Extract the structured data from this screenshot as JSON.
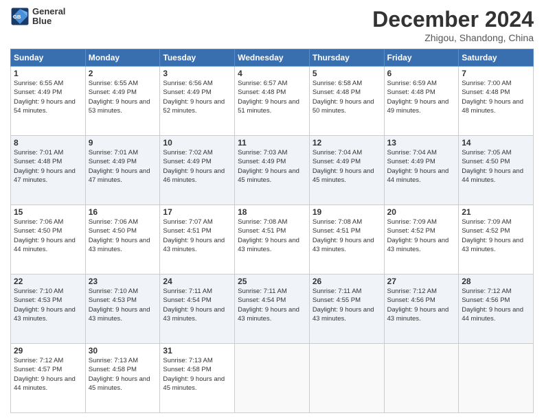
{
  "logo": {
    "line1": "General",
    "line2": "Blue"
  },
  "header": {
    "month": "December 2024",
    "location": "Zhigou, Shandong, China"
  },
  "days_of_week": [
    "Sunday",
    "Monday",
    "Tuesday",
    "Wednesday",
    "Thursday",
    "Friday",
    "Saturday"
  ],
  "weeks": [
    [
      {
        "day": "1",
        "sunrise": "6:55 AM",
        "sunset": "4:49 PM",
        "daylight": "9 hours and 54 minutes."
      },
      {
        "day": "2",
        "sunrise": "6:55 AM",
        "sunset": "4:49 PM",
        "daylight": "9 hours and 53 minutes."
      },
      {
        "day": "3",
        "sunrise": "6:56 AM",
        "sunset": "4:49 PM",
        "daylight": "9 hours and 52 minutes."
      },
      {
        "day": "4",
        "sunrise": "6:57 AM",
        "sunset": "4:48 PM",
        "daylight": "9 hours and 51 minutes."
      },
      {
        "day": "5",
        "sunrise": "6:58 AM",
        "sunset": "4:48 PM",
        "daylight": "9 hours and 50 minutes."
      },
      {
        "day": "6",
        "sunrise": "6:59 AM",
        "sunset": "4:48 PM",
        "daylight": "9 hours and 49 minutes."
      },
      {
        "day": "7",
        "sunrise": "7:00 AM",
        "sunset": "4:48 PM",
        "daylight": "9 hours and 48 minutes."
      }
    ],
    [
      {
        "day": "8",
        "sunrise": "7:01 AM",
        "sunset": "4:48 PM",
        "daylight": "9 hours and 47 minutes."
      },
      {
        "day": "9",
        "sunrise": "7:01 AM",
        "sunset": "4:49 PM",
        "daylight": "9 hours and 47 minutes."
      },
      {
        "day": "10",
        "sunrise": "7:02 AM",
        "sunset": "4:49 PM",
        "daylight": "9 hours and 46 minutes."
      },
      {
        "day": "11",
        "sunrise": "7:03 AM",
        "sunset": "4:49 PM",
        "daylight": "9 hours and 45 minutes."
      },
      {
        "day": "12",
        "sunrise": "7:04 AM",
        "sunset": "4:49 PM",
        "daylight": "9 hours and 45 minutes."
      },
      {
        "day": "13",
        "sunrise": "7:04 AM",
        "sunset": "4:49 PM",
        "daylight": "9 hours and 44 minutes."
      },
      {
        "day": "14",
        "sunrise": "7:05 AM",
        "sunset": "4:50 PM",
        "daylight": "9 hours and 44 minutes."
      }
    ],
    [
      {
        "day": "15",
        "sunrise": "7:06 AM",
        "sunset": "4:50 PM",
        "daylight": "9 hours and 44 minutes."
      },
      {
        "day": "16",
        "sunrise": "7:06 AM",
        "sunset": "4:50 PM",
        "daylight": "9 hours and 43 minutes."
      },
      {
        "day": "17",
        "sunrise": "7:07 AM",
        "sunset": "4:51 PM",
        "daylight": "9 hours and 43 minutes."
      },
      {
        "day": "18",
        "sunrise": "7:08 AM",
        "sunset": "4:51 PM",
        "daylight": "9 hours and 43 minutes."
      },
      {
        "day": "19",
        "sunrise": "7:08 AM",
        "sunset": "4:51 PM",
        "daylight": "9 hours and 43 minutes."
      },
      {
        "day": "20",
        "sunrise": "7:09 AM",
        "sunset": "4:52 PM",
        "daylight": "9 hours and 43 minutes."
      },
      {
        "day": "21",
        "sunrise": "7:09 AM",
        "sunset": "4:52 PM",
        "daylight": "9 hours and 43 minutes."
      }
    ],
    [
      {
        "day": "22",
        "sunrise": "7:10 AM",
        "sunset": "4:53 PM",
        "daylight": "9 hours and 43 minutes."
      },
      {
        "day": "23",
        "sunrise": "7:10 AM",
        "sunset": "4:53 PM",
        "daylight": "9 hours and 43 minutes."
      },
      {
        "day": "24",
        "sunrise": "7:11 AM",
        "sunset": "4:54 PM",
        "daylight": "9 hours and 43 minutes."
      },
      {
        "day": "25",
        "sunrise": "7:11 AM",
        "sunset": "4:54 PM",
        "daylight": "9 hours and 43 minutes."
      },
      {
        "day": "26",
        "sunrise": "7:11 AM",
        "sunset": "4:55 PM",
        "daylight": "9 hours and 43 minutes."
      },
      {
        "day": "27",
        "sunrise": "7:12 AM",
        "sunset": "4:56 PM",
        "daylight": "9 hours and 43 minutes."
      },
      {
        "day": "28",
        "sunrise": "7:12 AM",
        "sunset": "4:56 PM",
        "daylight": "9 hours and 44 minutes."
      }
    ],
    [
      {
        "day": "29",
        "sunrise": "7:12 AM",
        "sunset": "4:57 PM",
        "daylight": "9 hours and 44 minutes."
      },
      {
        "day": "30",
        "sunrise": "7:13 AM",
        "sunset": "4:58 PM",
        "daylight": "9 hours and 45 minutes."
      },
      {
        "day": "31",
        "sunrise": "7:13 AM",
        "sunset": "4:58 PM",
        "daylight": "9 hours and 45 minutes."
      },
      null,
      null,
      null,
      null
    ]
  ],
  "labels": {
    "sunrise": "Sunrise:",
    "sunset": "Sunset:",
    "daylight": "Daylight:"
  }
}
